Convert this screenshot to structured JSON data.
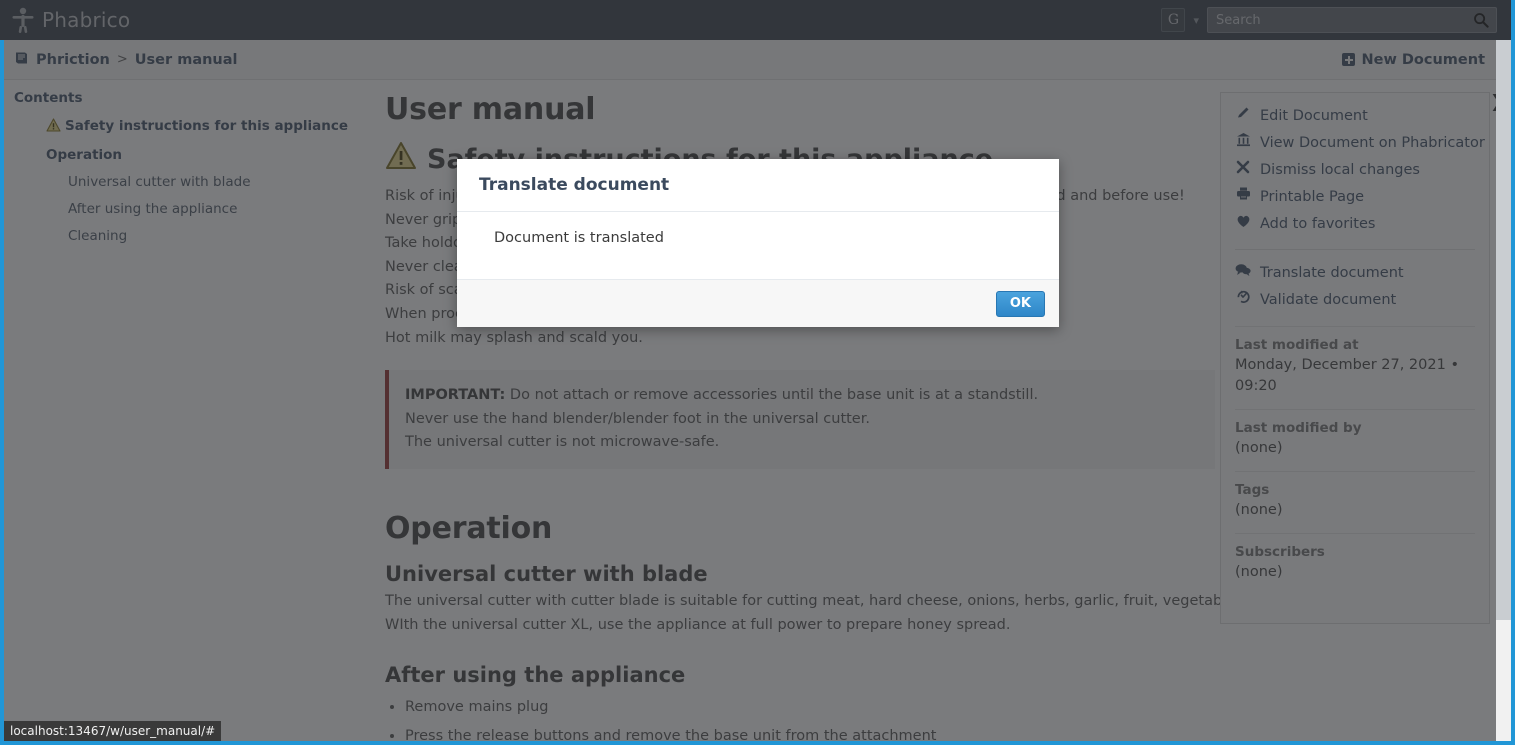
{
  "header": {
    "brand_title": "Phabrico",
    "brand_icon": "person-figure-icon",
    "avatar_initial": "G",
    "avatar_caret_icon": "chevron-down-icon",
    "search_placeholder": "Search",
    "search_value": "",
    "search_icon": "search-icon"
  },
  "breadcrumb": {
    "book_icon": "book-icon",
    "root": "Phriction",
    "separator": ">",
    "current": "User manual",
    "new_document_label": "New Document",
    "new_document_icon": "plus-square-icon"
  },
  "toc": {
    "title": "Contents",
    "items": [
      {
        "label": "Safety instructions for this appliance",
        "level": 1,
        "icon": "warning-triangle-icon"
      },
      {
        "label": "Operation",
        "level": 1,
        "icon": ""
      },
      {
        "label": "Universal cutter with blade",
        "level": 2,
        "icon": ""
      },
      {
        "label": "After using the appliance",
        "level": 2,
        "icon": ""
      },
      {
        "label": "Cleaning",
        "level": 2,
        "icon": ""
      }
    ]
  },
  "document": {
    "title": "User manual",
    "safety_heading": "Safety instructions for this appliance",
    "safety_heading_icon": "warning-triangle-icon",
    "safety_lines": [
      "Risk of injury! Always disconnect the appliance from the mains whenever it is left unattended and before use!",
      "Never grip the blade or the insert of the universal cutter with bare hands.",
      "Take holdof the cutter blade by its plastic handle only.",
      "Never clean the blade or the insert of the universal cutter with bare hands.",
      "Risk of scalding! Take care when processing hot liquids.",
      "When processing hot milk, use a tall, narrow receptacle for blending.",
      "Hot milk may splash and scald you."
    ],
    "note": {
      "lead": "IMPORTANT:",
      "lines": [
        " Do not attach or remove accessories until the base unit is at a standstill.",
        "Never use the hand blender/blender foot in the universal cutter.",
        "The universal cutter is not microwave-safe."
      ]
    },
    "operation_heading": "Operation",
    "universal_cutter_heading": "Universal cutter with blade",
    "universal_cutter_lines": [
      "The universal cutter with cutter blade is suitable for cutting meat, hard cheese, onions, herbs, garlic, fruit, vegetables, nuts, almonds.",
      "WIth the universal cutter XL, use the appliance at full power to prepare honey spread."
    ],
    "after_use_heading": "After using the appliance",
    "after_use_items": [
      "Remove mains plug",
      "Press the release buttons and remove the base unit from the attachment"
    ]
  },
  "side_panel": {
    "collapse_icon": "chevron-right-icon",
    "actions_group_1": [
      {
        "label": "Edit Document",
        "icon": "pencil-icon"
      },
      {
        "label": "View Document on Phabricator",
        "icon": "bank-icon"
      },
      {
        "label": "Dismiss local changes",
        "icon": "close-x-icon"
      },
      {
        "label": "Printable Page",
        "icon": "printer-icon"
      },
      {
        "label": "Add to favorites",
        "icon": "heart-icon"
      }
    ],
    "actions_group_2": [
      {
        "label": "Translate document",
        "icon": "comments-icon"
      },
      {
        "label": "Validate document",
        "icon": "validate-icon"
      }
    ],
    "meta": [
      {
        "label": "Last modified at",
        "value": "Monday, December 27, 2021 • 09:20"
      },
      {
        "label": "Last modified by",
        "value": "(none)"
      },
      {
        "label": "Tags",
        "value": "(none)"
      },
      {
        "label": "Subscribers",
        "value": "(none)"
      }
    ]
  },
  "modal": {
    "title": "Translate document",
    "message": "Document is translated",
    "ok_label": "OK"
  },
  "statusbar": {
    "url": "localhost:13467/w/user_manual/#"
  },
  "colors": {
    "header_bg": "#434a54",
    "link_blue": "#4b5a70",
    "accent_blue": "#2196d6",
    "button_blue": "#2e86c8",
    "note_border": "#9c3b3b",
    "warning_yellow": "#d9b441"
  }
}
